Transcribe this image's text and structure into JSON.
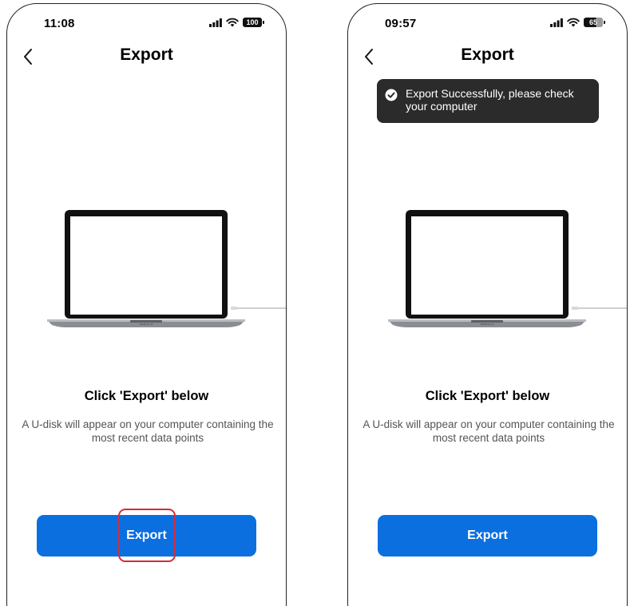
{
  "screens": [
    {
      "status_time": "11:08",
      "battery": "100",
      "title": "Export",
      "headline": "Click 'Export' below",
      "description_line1": "A U-disk will appear on your computer containing the",
      "description_line2": "most recent data points",
      "export_label": "Export",
      "laptop_label": "MacBook Air"
    },
    {
      "status_time": "09:57",
      "battery": "65",
      "title": "Export",
      "toast_line1": "Export Successfully, please check",
      "toast_line2": "your computer",
      "headline": "Click 'Export' below",
      "description_line1": "A U-disk will appear on your computer containing the",
      "description_line2": "most recent data points",
      "export_label": "Export",
      "laptop_label": "MacBook Air"
    }
  ],
  "colors": {
    "primary": "#0b6fe0",
    "toast_bg": "#2b2b2b",
    "highlight": "#d62b3a"
  },
  "icons": [
    "back-chevron-icon",
    "signal-icon",
    "wifi-icon",
    "battery-icon",
    "check-circle-icon",
    "laptop-illustration"
  ]
}
